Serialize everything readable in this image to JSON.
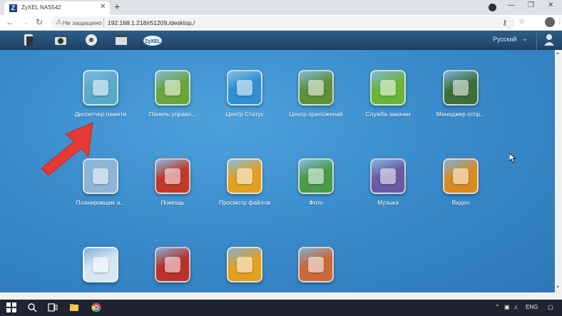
{
  "browser": {
    "tab_title": "ZyXEL NAS542",
    "favicon_letter": "Z",
    "new_tab": "+",
    "tab_close": "✕",
    "security_label": "Не защищено",
    "url": "192.168.1.218/r51209,/desktop,/"
  },
  "nas_header": {
    "language": "Русский",
    "language_chevron": "⌄"
  },
  "apps": [
    {
      "label": "Диспетчер памяти",
      "icon": "storage-manager-icon",
      "color": "#5aa9c8"
    },
    {
      "label": "Панель управл...",
      "icon": "control-panel-icon",
      "color": "#6aa53a"
    },
    {
      "label": "Центр Статус",
      "icon": "status-center-icon",
      "color": "#2f8fd1"
    },
    {
      "label": "Центр приложений",
      "icon": "app-center-icon",
      "color": "#5e8f3a"
    },
    {
      "label": "Служба закачки",
      "icon": "download-service-icon",
      "color": "#6ab43a"
    },
    {
      "label": "Менеджер отпр...",
      "icon": "upload-manager-icon",
      "color": "#3d6f3a"
    },
    {
      "label": "Планировщик а...",
      "icon": "archive-scheduler-icon",
      "color": "#8fb4d4"
    },
    {
      "label": "Помощь",
      "icon": "help-icon",
      "color": "#c0392b"
    },
    {
      "label": "Просмотр файлов",
      "icon": "file-browser-icon",
      "color": "#e0a020"
    },
    {
      "label": "Фото",
      "icon": "photo-icon",
      "color": "#4a9a4a"
    },
    {
      "label": "Музыка",
      "icon": "music-icon",
      "color": "#6a5aa0"
    },
    {
      "label": "Видео",
      "icon": "video-icon",
      "color": "#d98a20"
    },
    {
      "label": "",
      "icon": "zyxel-cloud-icon",
      "color": "#d8e6f2"
    },
    {
      "label": "",
      "icon": "media-player-icon",
      "color": "#b8322a"
    },
    {
      "label": "",
      "icon": "ebooks-icon",
      "color": "#e0a020"
    },
    {
      "label": "",
      "icon": "theme-icon",
      "color": "#c96a3a"
    }
  ],
  "taskbar": {
    "language": "ENG"
  }
}
